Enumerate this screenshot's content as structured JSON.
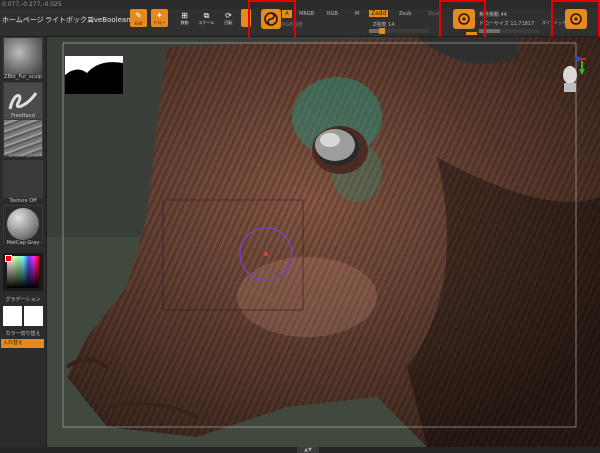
{
  "coords": "0.077,-0.277,-0.025",
  "tabs": {
    "home": "ホームページ",
    "lightbox": "ライトボックス",
    "liveboolean": "LiveBoolean"
  },
  "tools": [
    {
      "label": "Edit",
      "icon": "edit-icon",
      "active": true
    },
    {
      "label": "ドロー",
      "icon": "draw-icon",
      "active": true
    },
    {
      "label": "移動",
      "icon": "move-icon",
      "active": false
    },
    {
      "label": "スケール",
      "icon": "scale-icon",
      "active": false
    },
    {
      "label": "回転",
      "icon": "rotate-icon",
      "active": false
    }
  ],
  "symmetry_button_icon": "gyro-icon",
  "modes": {
    "a": "A",
    "mrgb": "MRGB",
    "rgb": "RGB",
    "m": "M",
    "zadd": "Zadd",
    "zsub": "Zsub",
    "zcut": "Zcut"
  },
  "rgb_intensity": "RGB強度",
  "z_intensity": "Z強度 14",
  "focal_shift": "焦点移動 44",
  "draw_size": "ドローサイズ 11.71817",
  "dynamic": "ダイナミック",
  "left_panel": {
    "brush_name": "ZBbt_Fur_sculp",
    "stroke_name": "FreeHand",
    "alpha_name": "BrushAlpha",
    "texture_name": "Texture Off",
    "material_name": "MatCap Gray",
    "gradient_label": "グラデーション",
    "color_switch_label": "カラー切り替え",
    "swap_button": "入れ替え"
  },
  "colors": {
    "accent": "#e58a1f",
    "highlight_box": "#e60000",
    "skin": "#8b5a44"
  }
}
